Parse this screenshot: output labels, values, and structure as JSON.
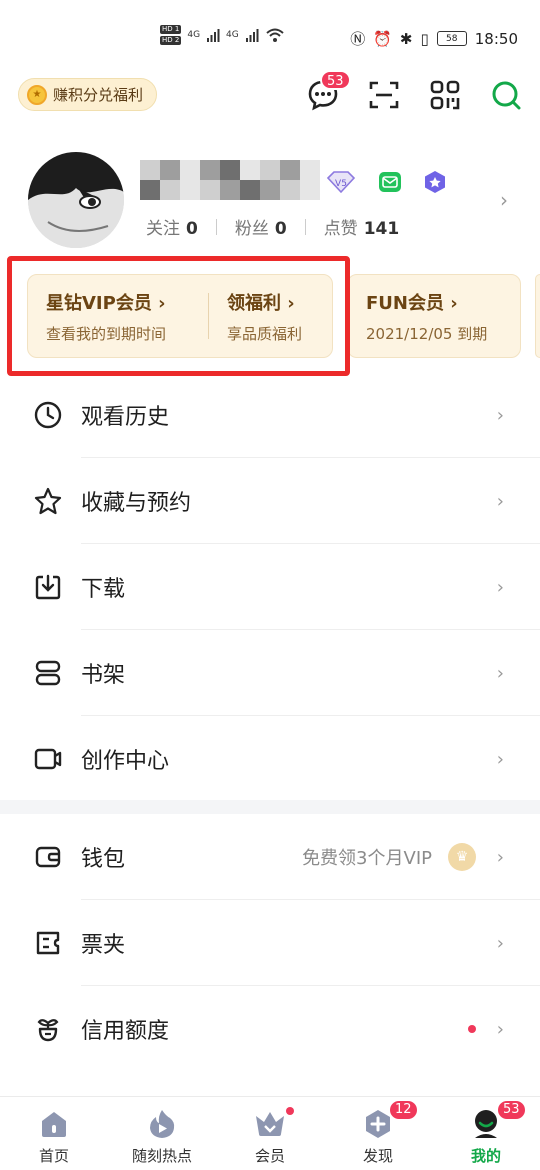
{
  "status_bar": {
    "hd1": "HD 1",
    "hd2": "HD 2",
    "signal1": "4G",
    "signal2": "4G",
    "battery": "58",
    "time": "18:50"
  },
  "topbar": {
    "points_label": "赚积分兑福利",
    "message_badge": "53"
  },
  "profile": {
    "stats": [
      {
        "label": "关注",
        "value": "0"
      },
      {
        "label": "粉丝",
        "value": "0"
      },
      {
        "label": "点赞",
        "value": "141"
      }
    ],
    "vip_level": "V5"
  },
  "vip_cards": {
    "card1": {
      "title": "星钻VIP会员 ›",
      "subtitle": "查看我的到期时间",
      "title2": "领福利 ›",
      "subtitle2": "享品质福利"
    },
    "card2": {
      "title": "FUN会员 ›",
      "subtitle": "2021/12/05 到期"
    }
  },
  "menu": [
    {
      "label": "观看历史",
      "icon": "clock-icon"
    },
    {
      "label": "收藏与预约",
      "icon": "star-icon"
    },
    {
      "label": "下载",
      "icon": "download-icon"
    },
    {
      "label": "书架",
      "icon": "bookshelf-icon"
    },
    {
      "label": "创作中心",
      "icon": "camera-icon"
    }
  ],
  "menu2": [
    {
      "label": "钱包",
      "icon": "wallet-icon",
      "hint": "免费领3个月VIP"
    },
    {
      "label": "票夹",
      "icon": "ticket-icon"
    },
    {
      "label": "信用额度",
      "icon": "credit-icon"
    }
  ],
  "tabs": [
    {
      "label": "首页"
    },
    {
      "label": "随刻热点"
    },
    {
      "label": "会员"
    },
    {
      "label": "发现",
      "badge": "12"
    },
    {
      "label": "我的",
      "badge": "53"
    }
  ],
  "colors": {
    "accent_green": "#13a849",
    "badge_red": "#f0385a",
    "highlight_red": "#ec2a2a",
    "vip_gold": "#6b4413"
  }
}
